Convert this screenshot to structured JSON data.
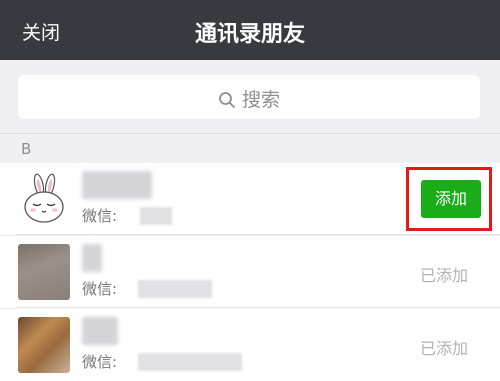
{
  "navbar": {
    "close_label": "关闭",
    "title": "通讯录朋友"
  },
  "search": {
    "placeholder": "搜索",
    "icon": "search-icon"
  },
  "section": {
    "letter": "B"
  },
  "contacts": [
    {
      "wechat_label": "微信:",
      "action_label": "添加",
      "action_state": "add",
      "avatar": "bunny-icon"
    },
    {
      "wechat_label": "微信:",
      "action_label": "已添加",
      "action_state": "added",
      "avatar": "photo"
    },
    {
      "wechat_label": "微信:",
      "action_label": "已添加",
      "action_state": "added",
      "avatar": "photo"
    }
  ],
  "colors": {
    "navbar_bg": "#393a3f",
    "add_button": "#1aad19",
    "highlight_box": "#e01b1b"
  }
}
